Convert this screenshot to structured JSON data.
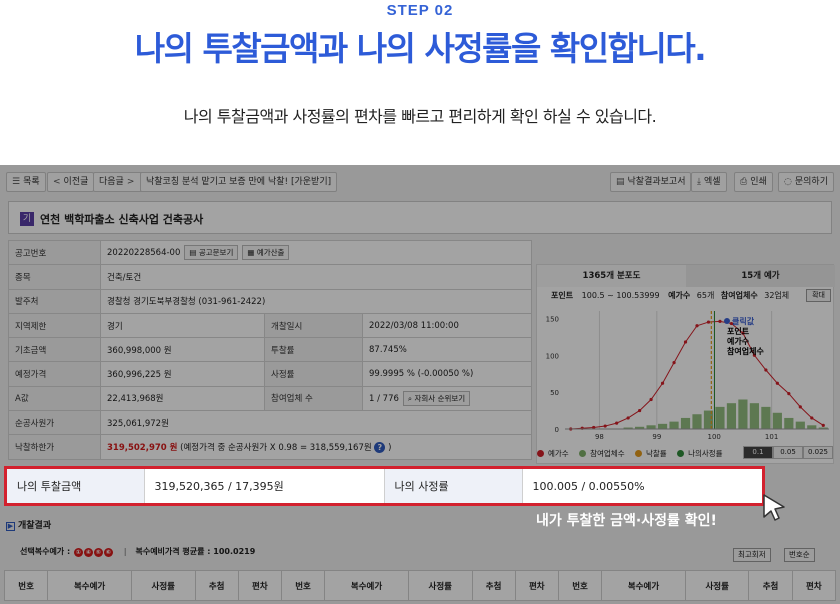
{
  "hero": {
    "step": "STEP 02",
    "headline": "나의 투찰금액과 나의 사정률을 확인합니다.",
    "subline": "나의 투찰금액과 사정률의 편차를 빠르고 편리하게 확인 하실 수 있습니다."
  },
  "toolbar": {
    "list": "목록",
    "prev": "이전글",
    "next": "다음글",
    "ai_coach": "낙찰코칭 분석 맡기고 보증 만에 낙찰! [가운받기]",
    "report": "낙찰결과보고서",
    "excel": "엑셀",
    "print": "인쇄",
    "inquiry": "문의하기"
  },
  "project": {
    "badge": "기",
    "title": "연천 백학파출소 신축사업 건축공사"
  },
  "info": {
    "notice_no_label": "공고번호",
    "notice_no": "20220228564-00",
    "notice_view": "공고문보기",
    "preprice_calc": "예가산출",
    "type_label": "종목",
    "type": "건축/토건",
    "agency_label": "발주처",
    "agency": "경찰청 경기도북부경찰청 (031-961-2422)",
    "region_label": "지역제한",
    "region": "경기",
    "open_label": "개찰일시",
    "open": "2022/03/08 11:00:00",
    "base_label": "기초금액",
    "base": "360,998,000 원",
    "bidrate_label": "투찰률",
    "bidrate": "87.745%",
    "est_label": "예정가격",
    "est": "360,996,225 원",
    "adj_label": "사정률",
    "adj": "99.9995 % (-0.00050 %)",
    "a_label": "A값",
    "a": "22,413,968원",
    "part_label": "참여업체 수",
    "part": "1 / 776",
    "rank_btn": "자회사 순위보기",
    "net_label": "순공사원가",
    "net": "325,061,972원",
    "min_label": "낙찰하한가",
    "min_amount": "319,502,970 원",
    "min_note": "(예정가격 중 순공사원가 X 0.98 = 318,559,167원",
    "help_icon": "?",
    "min_note_end": ")"
  },
  "chart_panel": {
    "tab1": "1365개 분포도",
    "tab2": "15개 예가",
    "point_label": "포인트",
    "point_range": "100.5 ~ 100.53999",
    "preprice_label": "예가수",
    "preprice_count": "65개",
    "part_label": "참여업체수",
    "part_count": "32업체",
    "zoom": "확대",
    "tooltip": {
      "title": "클릭값",
      "l1": "포인트",
      "l2": "예가수",
      "l3": "참여업체수"
    },
    "legend": [
      "예가수",
      "참여업체수",
      "낙찰률",
      "나의사정률"
    ],
    "segments": [
      "0.1",
      "0.05",
      "0.025"
    ],
    "colors": {
      "red": "#d0202a",
      "green": "#7fb069",
      "orange": "#e39a1c",
      "darkgreen": "#2f8a3a"
    }
  },
  "chart_data": {
    "type": "bar",
    "title": "1365개 분포도",
    "x": [
      97.5,
      97.7,
      97.9,
      98.1,
      98.3,
      98.5,
      98.7,
      98.9,
      99.1,
      99.3,
      99.5,
      99.7,
      99.9,
      100.1,
      100.3,
      100.5,
      100.7,
      100.9,
      101.1,
      101.3,
      101.5,
      101.7,
      101.9
    ],
    "series": [
      {
        "name": "참여업체수",
        "values": [
          0,
          0,
          0,
          0,
          0,
          2,
          3,
          5,
          7,
          10,
          15,
          20,
          25,
          30,
          35,
          40,
          35,
          30,
          22,
          15,
          10,
          5,
          2
        ]
      },
      {
        "name": "예가수",
        "values": [
          0,
          1,
          2,
          4,
          8,
          15,
          25,
          40,
          62,
          90,
          118,
          140,
          145,
          146,
          143,
          130,
          100,
          80,
          62,
          48,
          30,
          15,
          5
        ]
      }
    ],
    "markers": [
      {
        "name": "낙찰률",
        "x": 99.95
      },
      {
        "name": "나의사정률",
        "x": 100.005
      }
    ],
    "xticks": [
      98,
      99,
      100,
      101
    ],
    "yticks": [
      0,
      50,
      100,
      150
    ],
    "ylim": [
      0,
      160
    ],
    "xlim": [
      97.4,
      102.0
    ]
  },
  "result": {
    "bid_label": "나의 투찰금액",
    "bid": "319,520,365 / 17,395원",
    "rate_label": "나의 사정률",
    "rate": "100.005 / 0.00550%"
  },
  "callout": "내가 투찰한 금액·사정률 확인!",
  "section": {
    "title": "개찰결과",
    "icon": "▶"
  },
  "selection": {
    "label": "선택복수예가 :",
    "nums": [
      "①",
      "④",
      "⑤",
      "⑥"
    ],
    "avg": "복수예비가격 평균률 : 100.0219"
  },
  "sort": {
    "latest": "최고회저",
    "number": "번호순"
  },
  "bottom_headers": [
    "번호",
    "복수예가",
    "사정률",
    "추첨",
    "편차",
    "번호",
    "복수예가",
    "사정률",
    "추첨",
    "편차",
    "번호",
    "복수예가",
    "사정률",
    "추첨",
    "편차"
  ]
}
